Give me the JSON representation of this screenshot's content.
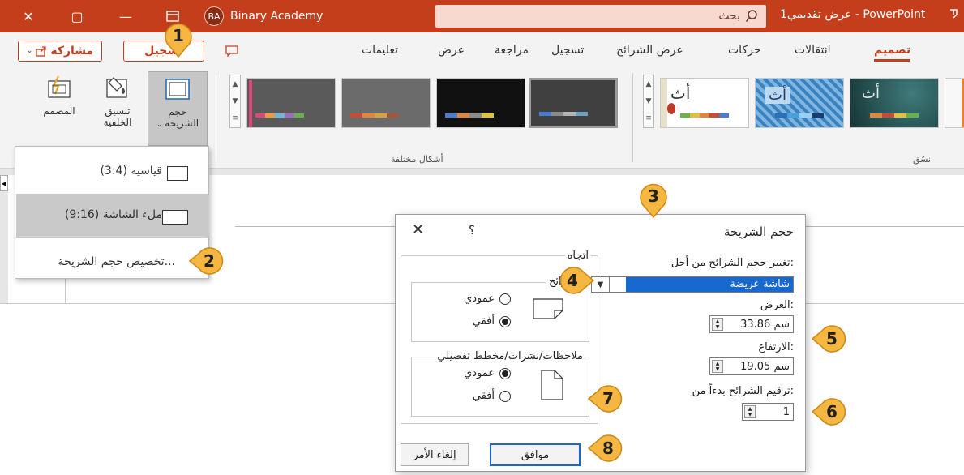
{
  "colors": {
    "brand": "#c43e1c",
    "accent_blue": "#1769d0",
    "callout_fill": "#f5b642"
  },
  "titlebar": {
    "close": "✕",
    "restore": "▢",
    "minimize": "—",
    "account_initials": "BA",
    "account_name": "Binary Academy",
    "search_label": "بحث",
    "doc_title": "عرض تقديمي1 - PowerPoint"
  },
  "ribbon": {
    "share": "مشاركة",
    "record": "تسجيل",
    "tabs": [
      "تعليمات",
      "عرض",
      "مراجعة",
      "تسجيل",
      "عرض الشرائح",
      "حركات",
      "انتقالات",
      "تصميم"
    ],
    "commands": {
      "designer": "المصمم",
      "format_bg_line1": "تنسيق",
      "format_bg_line2": "الخلفية",
      "slide_size_line1": "حجم",
      "slide_size_line2": "الشريحة"
    },
    "groups": {
      "variants": "أشكال مختلفة",
      "themes": "نسُق"
    },
    "theme_glyph": "أث"
  },
  "slide_size_menu": {
    "standard": "قياسية (3:4)",
    "widescreen": "ملء الشاشة (9:16)",
    "custom": "تخصيص حجم الشريحة..."
  },
  "dialog": {
    "title": "حجم الشريحة",
    "close": "✕",
    "help": "؟",
    "size_for_label": "تغيير حجم الشرائح من أجل:",
    "size_for_value": "شاشة عريضة",
    "width_label": "العرض:",
    "width_value": "33.86 سم",
    "height_label": "الارتفاع:",
    "height_value": "19.05 سم",
    "number_from_label": "ترقيم الشرائح بدءاً من:",
    "number_from_value": "1",
    "orientation_title": "اتجاه",
    "slides_group": "الشرائح",
    "notes_group": "ملاحظات/نشرات/مخطط تفصيلي",
    "portrait": "عمودي",
    "landscape": "أفقي",
    "slides_orientation": "landscape",
    "notes_orientation": "portrait",
    "ok": "موافق",
    "cancel": "إلغاء الأمر"
  },
  "callouts": [
    "1",
    "2",
    "3",
    "4",
    "5",
    "6",
    "7",
    "8"
  ]
}
